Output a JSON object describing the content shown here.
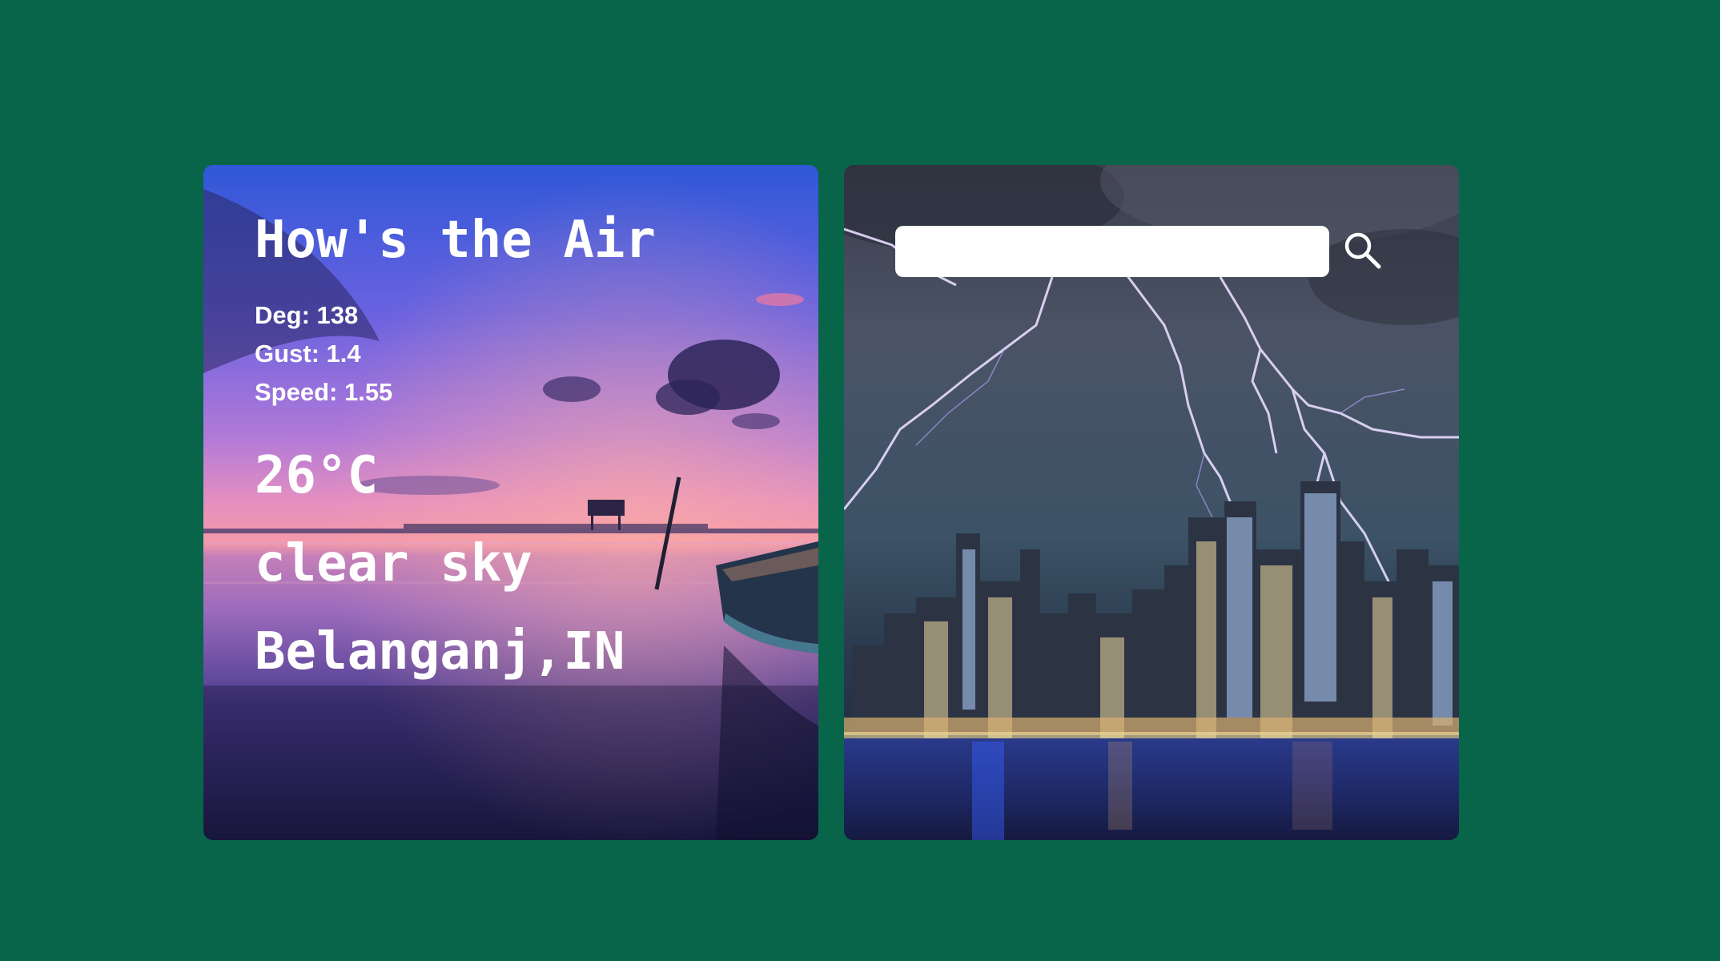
{
  "weather": {
    "title": "How's the Air",
    "wind": {
      "deg": "Deg: 138",
      "gust": "Gust: 1.4",
      "speed": "Speed: 1.55"
    },
    "temperature": "26°C",
    "description": "clear sky",
    "location": "Belanganj,IN"
  },
  "search": {
    "value": "",
    "placeholder": "",
    "icon": "search-icon"
  },
  "colors": {
    "page_background": "#08654a",
    "search_field": "#ffffff",
    "text": "#ffffff"
  }
}
